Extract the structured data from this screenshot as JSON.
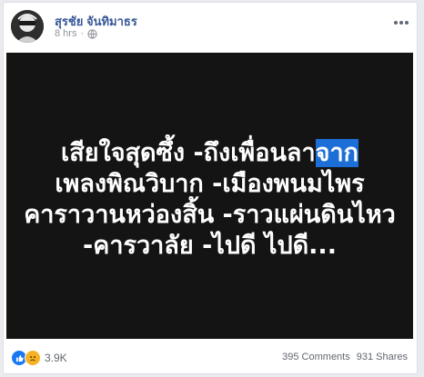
{
  "post": {
    "author": "สุรชัย จันทิมาธร",
    "time": "8 hrs",
    "time_separator": "·",
    "audience_icon": "globe-icon",
    "menu_icon": "more-options-icon"
  },
  "image_text": {
    "line1_main": "เสียใจสุดซึ้ง -ถึงเพื่อนลา",
    "line1_highlight": "จาก",
    "line2": "เพลงพิณวิบาก -เมืองพนมไพร",
    "line3": "คาราวานหว่องสิ้น -ราวแผ่นดินไหว",
    "line4": "-คารวาลัย -ไปดี ไปดี..."
  },
  "footer": {
    "reaction_icons": [
      "like-icon",
      "sad-icon"
    ],
    "reaction_count": "3.9K",
    "comments": "395 Comments",
    "shares": "931 Shares"
  },
  "colors": {
    "author": "#385898",
    "image_background": "#141414",
    "highlight": "#1c6fd6",
    "like": "#1877f2",
    "sad": "#f7b125"
  }
}
